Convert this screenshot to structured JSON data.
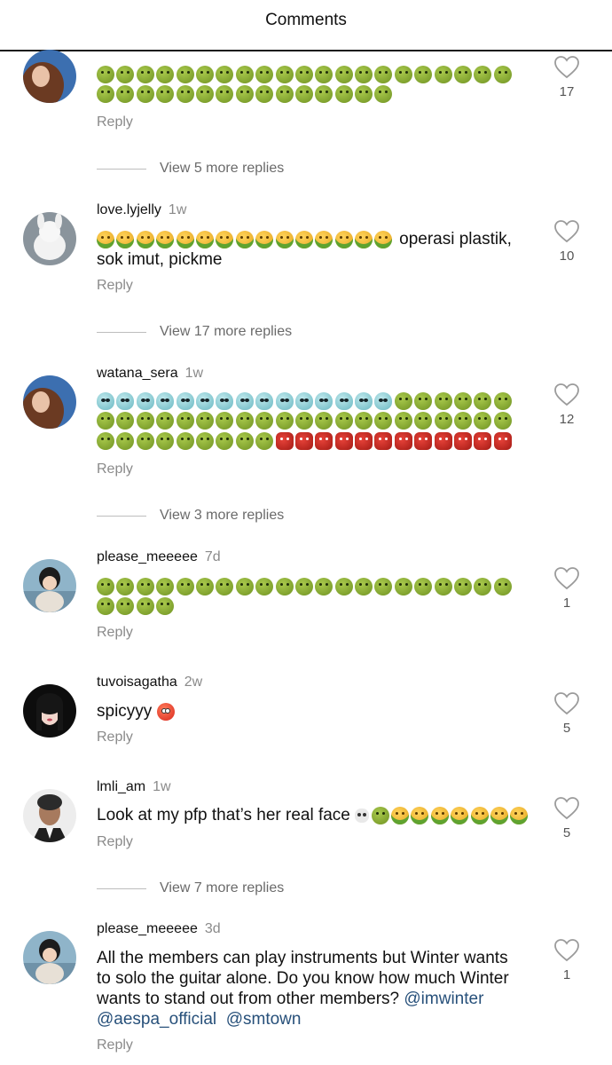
{
  "header": {
    "title": "Comments"
  },
  "comments": [
    {
      "username": "",
      "time": "",
      "emoji_rows": [
        [
          "nausea",
          "nausea",
          "nausea",
          "nausea",
          "nausea",
          "nausea",
          "nausea",
          "nausea",
          "nausea",
          "nausea",
          "nausea",
          "nausea",
          "nausea",
          "nausea",
          "nausea",
          "nausea",
          "nausea",
          "nausea",
          "nausea",
          "nausea",
          "nausea"
        ],
        [
          "nausea",
          "nausea",
          "nausea",
          "nausea",
          "nausea",
          "nausea",
          "nausea",
          "nausea",
          "nausea",
          "nausea",
          "nausea",
          "nausea",
          "nausea",
          "nausea",
          "nausea"
        ]
      ],
      "likes": "17",
      "reply_label": "Reply",
      "view_more": "View 5 more replies",
      "avatar": "avatar-brown-hair-blue-sky"
    },
    {
      "username": "love.lyjelly",
      "time": "1w",
      "text": "operasi plastik, sok imut, pickme",
      "lead_emoji_count": 15,
      "lead_emoji": "vomit",
      "likes": "10",
      "reply_label": "Reply",
      "view_more": "View 17 more replies",
      "avatar": "avatar-white-plush-toy"
    },
    {
      "username": "watana_sera",
      "time": "1w",
      "emoji_rows": [
        [
          "alien",
          "alien",
          "alien",
          "alien",
          "alien",
          "alien",
          "alien",
          "alien",
          "alien",
          "alien",
          "alien",
          "alien",
          "alien",
          "alien",
          "alien",
          "nausea",
          "nausea",
          "nausea",
          "nausea",
          "nausea",
          "nausea"
        ],
        [
          "nausea",
          "nausea",
          "nausea",
          "nausea",
          "nausea",
          "nausea",
          "nausea",
          "nausea",
          "nausea",
          "nausea",
          "nausea",
          "nausea",
          "nausea",
          "nausea",
          "nausea",
          "nausea",
          "nausea",
          "nausea",
          "nausea",
          "nausea",
          "nausea"
        ],
        [
          "nausea",
          "nausea",
          "nausea",
          "nausea",
          "nausea",
          "nausea",
          "nausea",
          "nausea",
          "nausea",
          "ogre",
          "ogre",
          "ogre",
          "ogre",
          "ogre",
          "ogre",
          "ogre",
          "ogre",
          "ogre",
          "ogre",
          "ogre",
          "ogre"
        ]
      ],
      "likes": "12",
      "reply_label": "Reply",
      "view_more": "View 3 more replies",
      "avatar": "avatar-brown-hair-blue-sky"
    },
    {
      "username": "please_meeeee",
      "time": "7d",
      "emoji_rows": [
        [
          "nausea",
          "nausea",
          "nausea",
          "nausea",
          "nausea",
          "nausea",
          "nausea",
          "nausea",
          "nausea",
          "nausea",
          "nausea",
          "nausea",
          "nausea",
          "nausea",
          "nausea",
          "nausea",
          "nausea",
          "nausea",
          "nausea",
          "nausea",
          "nausea"
        ],
        [
          "nausea",
          "nausea",
          "nausea",
          "nausea"
        ]
      ],
      "likes": "1",
      "reply_label": "Reply",
      "avatar": "avatar-painting-figure"
    },
    {
      "username": "tuvoisagatha",
      "time": "2w",
      "text": "spicyyy",
      "likes": "5",
      "reply_label": "Reply",
      "avatar": "avatar-dark-hair-woman"
    },
    {
      "username": "lmli_am",
      "time": "1w",
      "text": "Look at my pfp that’s her real face",
      "likes": "5",
      "reply_label": "Reply",
      "view_more": "View 7 more replies",
      "avatar": "avatar-3d-figure"
    },
    {
      "username": "please_meeeee",
      "time": "3d",
      "text_lines": [
        "All the members can play instruments but Winter wants",
        "to solo the guitar alone. Do you know how much Winter",
        "wants to stand out from other members?"
      ],
      "mentions": [
        "@imwinter",
        "@aespa_official",
        "@smtown"
      ],
      "likes": "1",
      "reply_label": "Reply",
      "avatar": "avatar-painting-figure"
    }
  ]
}
